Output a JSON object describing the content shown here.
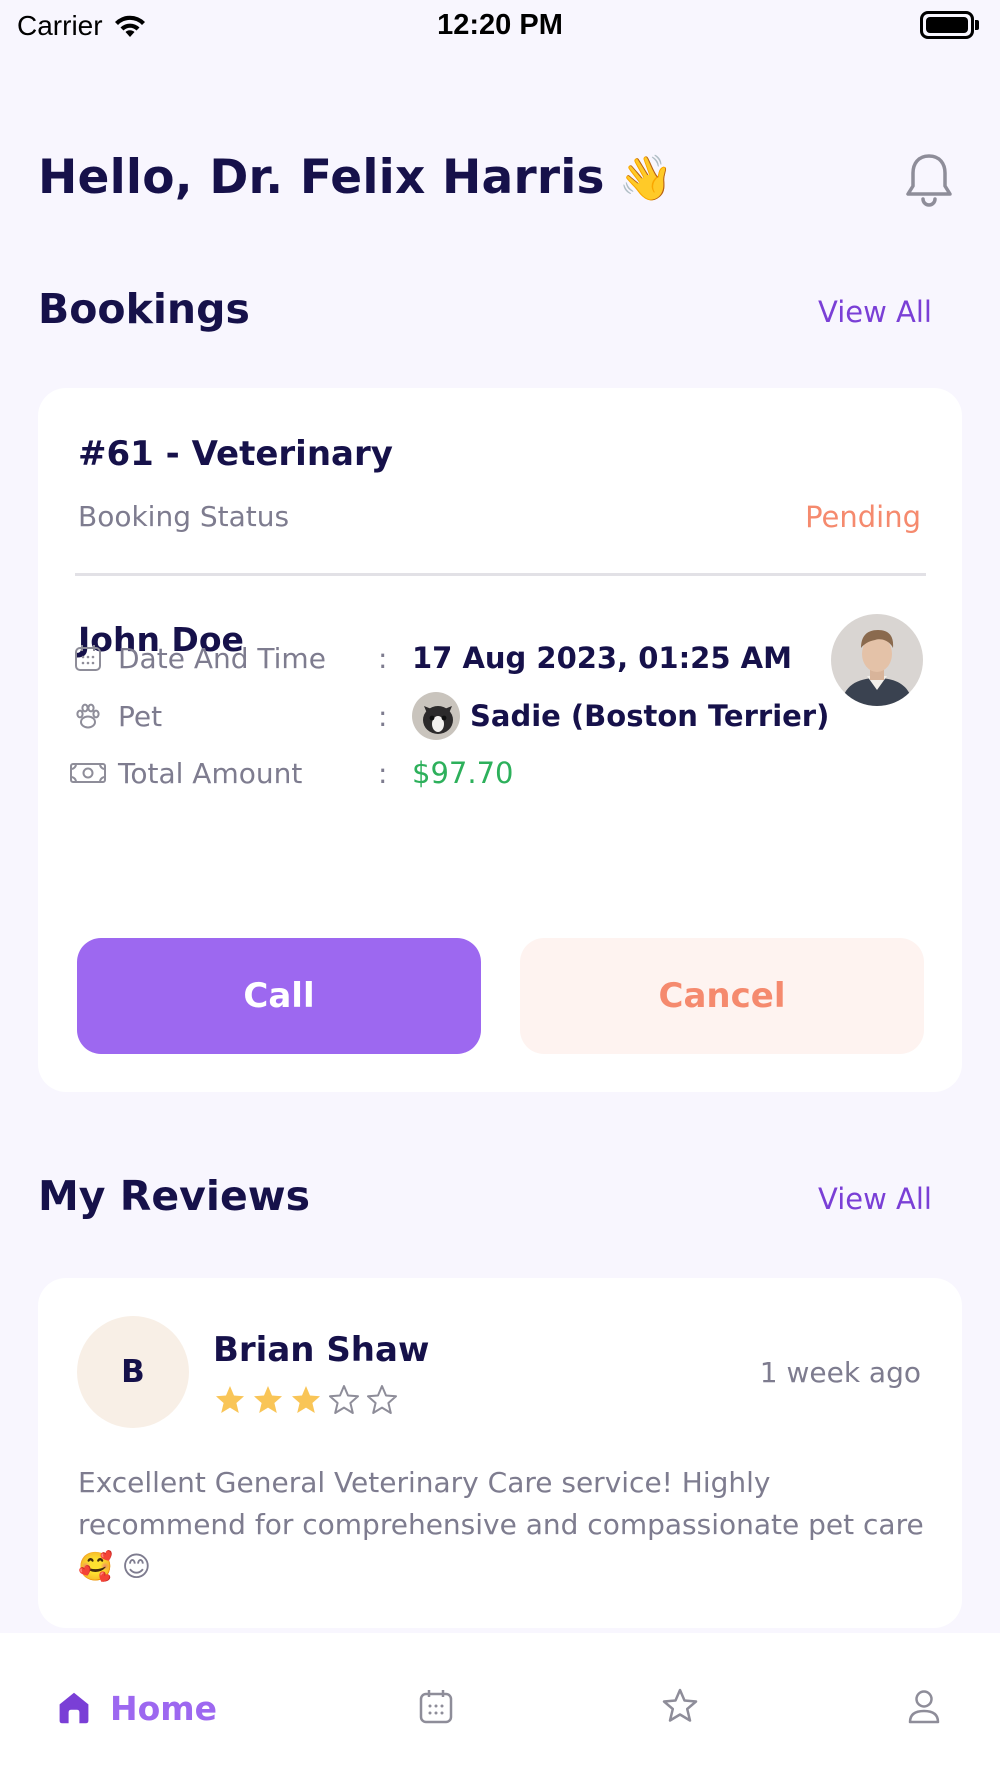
{
  "status_bar": {
    "carrier": "Carrier",
    "time": "12:20 PM"
  },
  "header": {
    "greeting": "Hello, Dr. Felix Harris",
    "wave_emoji": "👋"
  },
  "bookings": {
    "section_title": "Bookings",
    "view_all": "View All",
    "card": {
      "title": "#61 - Veterinary",
      "status_label": "Booking Status",
      "status_value": "Pending",
      "customer_name": "John Doe",
      "rows": [
        {
          "icon": "calendar-icon",
          "label": "Date And Time",
          "colon": ":",
          "value": "17 Aug 2023, 01:25 AM"
        },
        {
          "icon": "paw-icon",
          "label": "Pet",
          "colon": ":",
          "value": "Sadie (Boston Terrier)"
        },
        {
          "icon": "money-icon",
          "label": "Total Amount",
          "colon": ":",
          "value": "$97.70"
        }
      ],
      "call_label": "Call",
      "cancel_label": "Cancel"
    }
  },
  "reviews": {
    "section_title": "My Reviews",
    "view_all": "View All",
    "items": [
      {
        "initial": "B",
        "name": "Brian Shaw",
        "rating": 3,
        "max_rating": 5,
        "time": "1 week ago",
        "text": "Excellent General Veterinary Care service! Highly recommend for comprehensive and compassionate pet care🥰 😊"
      }
    ]
  },
  "tab_bar": {
    "home_label": "Home",
    "tabs": [
      "home-icon",
      "calendar-tab-icon",
      "star-tab-icon",
      "profile-icon"
    ]
  },
  "colors": {
    "primary": "#9D68F0",
    "link": "#7A3FD6",
    "pending": "#F58A6E",
    "amount": "#2DB05B",
    "star": "#F9C557",
    "text_dark": "#16114A",
    "text_muted": "#7E7C8F",
    "background": "#F8F6FE"
  }
}
